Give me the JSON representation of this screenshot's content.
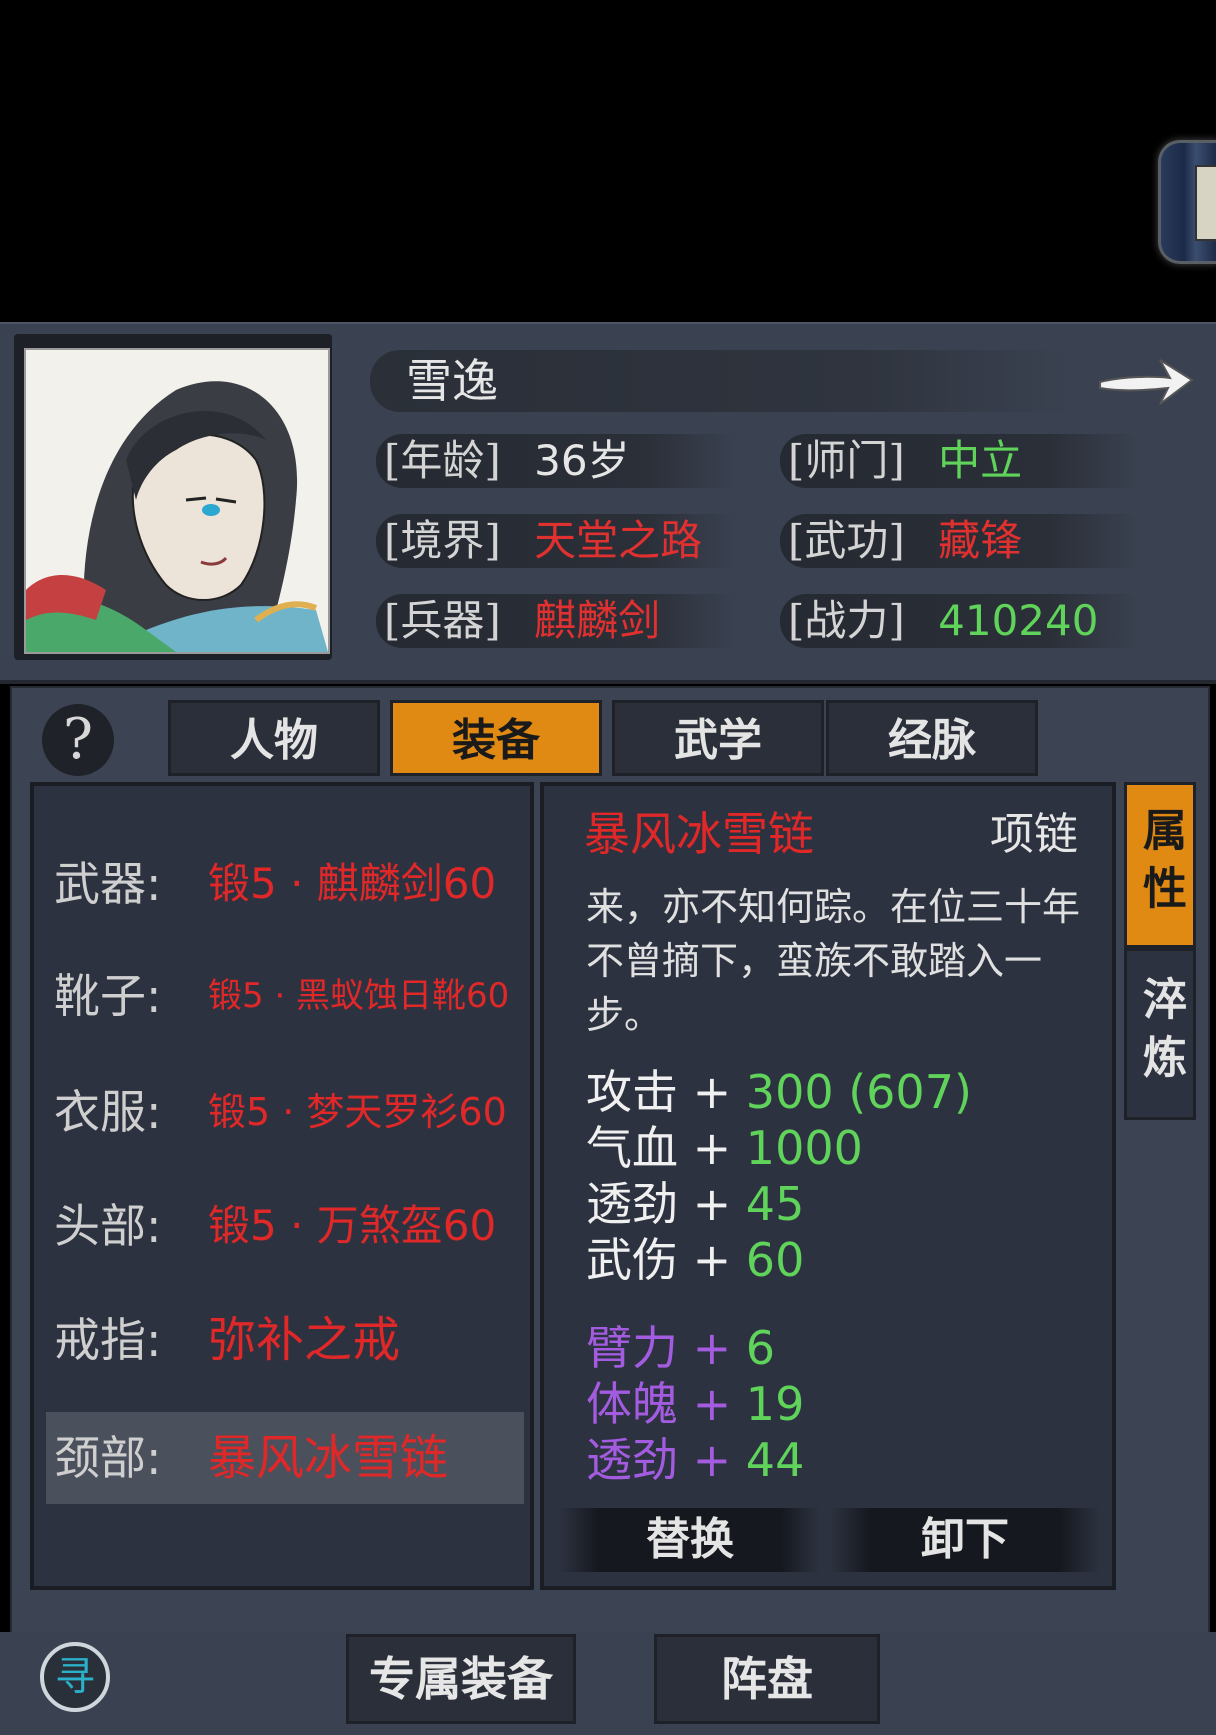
{
  "character": {
    "name": "雪逸",
    "info": [
      {
        "label": "[年龄]",
        "value": "36岁",
        "color": "white"
      },
      {
        "label": "[师门]",
        "value": "中立",
        "color": "green"
      },
      {
        "label": "[境界]",
        "value": "天堂之路",
        "color": "red"
      },
      {
        "label": "[武功]",
        "value": "藏锋",
        "color": "red"
      },
      {
        "label": "[兵器]",
        "value": "麒麟剑",
        "color": "red"
      },
      {
        "label": "[战力]",
        "value": "410240",
        "color": "green"
      }
    ]
  },
  "tabs": [
    "人物",
    "装备",
    "武学",
    "经脉"
  ],
  "active_tab": "装备",
  "help_label": "?",
  "slots": [
    {
      "label": "武器:",
      "value": "锻5 · 麒麟剑60"
    },
    {
      "label": "靴子:",
      "value": "锻5 · 黑蚁蚀日靴60"
    },
    {
      "label": "衣服:",
      "value": "锻5 · 梦天罗衫60"
    },
    {
      "label": "头部:",
      "value": "锻5 · 万煞盔60"
    },
    {
      "label": "戒指:",
      "value": "弥补之戒"
    },
    {
      "label": "颈部:",
      "value": "暴风冰雪链"
    }
  ],
  "detail": {
    "item_name": "暴风冰雪链",
    "item_type": "项链",
    "description": "来，亦不知何踪。在位三十年不曾摘下，蛮族不敢踏入一步。",
    "stats": [
      {
        "name": "攻击",
        "plus": "+",
        "value": "300 (607)"
      },
      {
        "name": "气血",
        "plus": "+",
        "value": "1000"
      },
      {
        "name": "透劲",
        "plus": "+",
        "value": "45"
      },
      {
        "name": "武伤",
        "plus": "+",
        "value": "60"
      }
    ],
    "bonus_stats": [
      {
        "name": "臂力",
        "plus": "+",
        "value": "6"
      },
      {
        "name": "体魄",
        "plus": "+",
        "value": "19"
      },
      {
        "name": "透劲",
        "plus": "+",
        "value": "44"
      }
    ],
    "replace_label": "替换",
    "unequip_label": "卸下"
  },
  "side_tabs": {
    "attributes": "属性",
    "refine": "淬炼"
  },
  "bottom": {
    "seek_icon_char": "寻",
    "exclusive_label": "专属装备",
    "formation_label": "阵盘"
  }
}
